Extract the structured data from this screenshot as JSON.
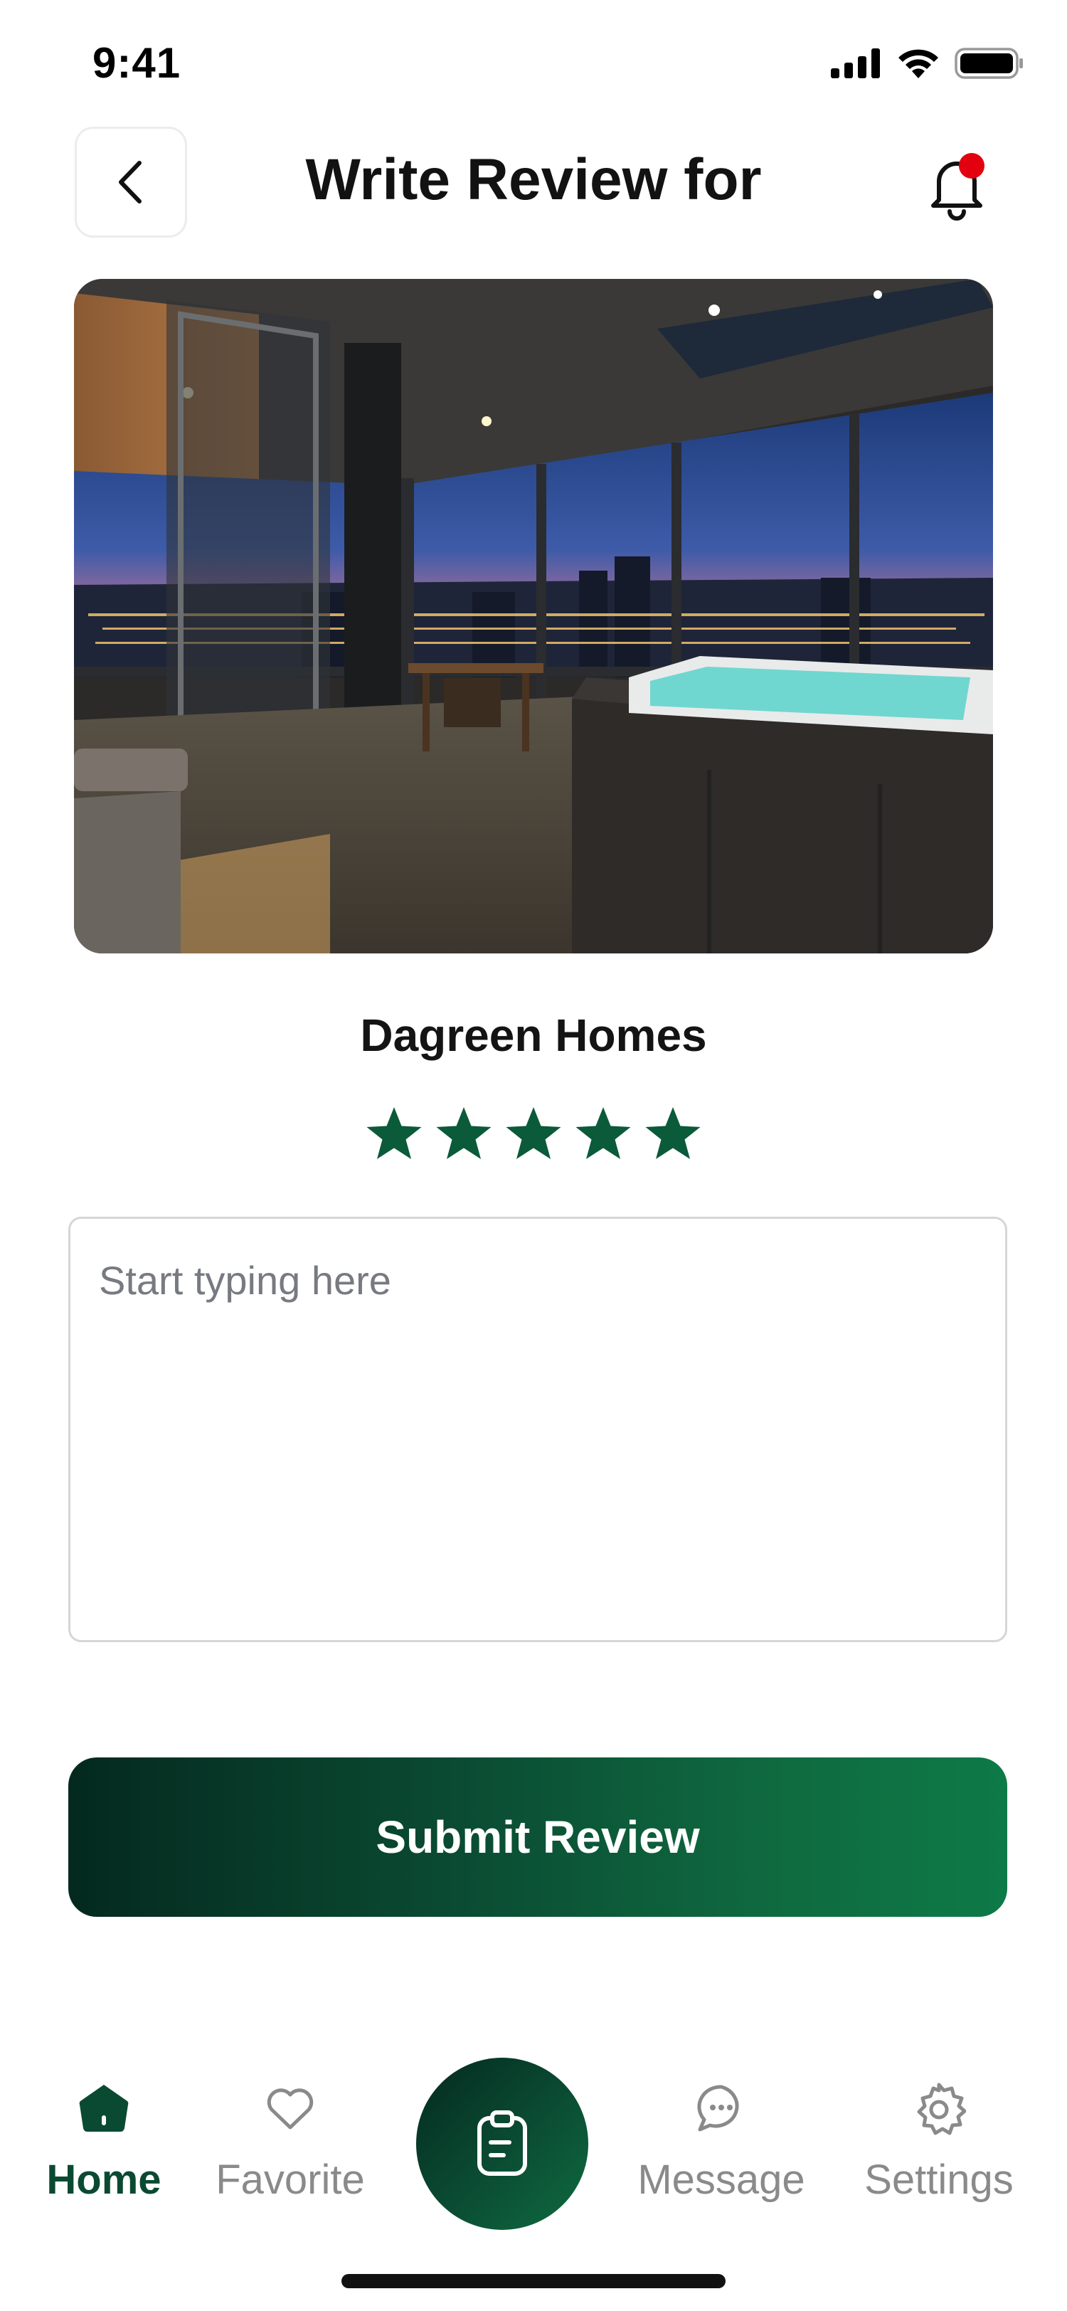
{
  "status_bar": {
    "time": "9:41"
  },
  "header": {
    "title": "Write Review for"
  },
  "property": {
    "name": "Dagreen Homes",
    "rating": 5,
    "rating_max": 5
  },
  "review": {
    "placeholder": "Start typing here",
    "value": ""
  },
  "submit": {
    "label": "Submit Review"
  },
  "tab_bar": {
    "items": [
      {
        "label": "Home",
        "icon": "home-icon",
        "active": true
      },
      {
        "label": "Favorite",
        "icon": "heart-icon",
        "active": false
      },
      {
        "label": "",
        "icon": "clipboard-icon",
        "active": false
      },
      {
        "label": "Message",
        "icon": "chat-bubble-icon",
        "active": false
      },
      {
        "label": "Settings",
        "icon": "gear-icon",
        "active": false
      }
    ]
  },
  "colors": {
    "brand_dark": "#04291f",
    "brand": "#0b4a32",
    "brand_light": "#0d7a47",
    "notification_dot": "#e3000f",
    "inactive": "#8a8a8a"
  }
}
